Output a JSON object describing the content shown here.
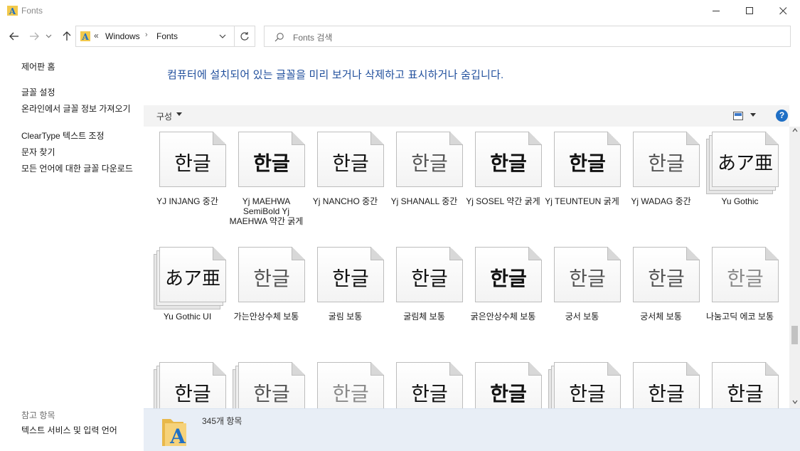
{
  "window": {
    "title": "Fonts"
  },
  "address": {
    "overflow": "«",
    "segments": [
      "Windows",
      "Fonts"
    ]
  },
  "search": {
    "placeholder": "Fonts 검색"
  },
  "left_pane": {
    "home": "제어판 홈",
    "links": [
      "글꼴 설정",
      "온라인에서 글꼴 정보 가져오기",
      "ClearType 텍스트 조정",
      "문자 찾기",
      "모든 언어에 대한 글꼴 다운로드"
    ],
    "see_also_title": "참고 항목",
    "see_also": [
      "텍스트 서비스 및 입력 언어"
    ]
  },
  "main": {
    "headline": "컴퓨터에 설치되어 있는 글꼴을 미리 보거나 삭제하고 표시하거나 숨깁니다.",
    "organize": "구성",
    "help": "?"
  },
  "fonts": [
    {
      "name": "YJ INJANG 중간",
      "sample": "한글",
      "stack": 1,
      "style": "serif"
    },
    {
      "name": "Yj MAEHWA SemiBold Yj MAEHWA 약간 굵게",
      "sample": "한글",
      "stack": 1,
      "style": "serif bold"
    },
    {
      "name": "Yj NANCHO 중간",
      "sample": "한글",
      "stack": 1,
      "style": "serif"
    },
    {
      "name": "Yj SHANALL 중간",
      "sample": "한글",
      "stack": 1,
      "style": "light"
    },
    {
      "name": "Yj SOSEL 약간 굵게",
      "sample": "한글",
      "stack": 1,
      "style": "bold"
    },
    {
      "name": "Yj TEUNTEUN 굵게",
      "sample": "한글",
      "stack": 1,
      "style": "bold"
    },
    {
      "name": "Yj WADAG 중간",
      "sample": "한글",
      "stack": 1,
      "style": "light"
    },
    {
      "name": "Yu Gothic",
      "sample": "あア亜",
      "stack": 3,
      "style": "jp"
    },
    {
      "name": "Yu Gothic UI",
      "sample": "あア亜",
      "stack": 3,
      "style": "jp"
    },
    {
      "name": "가는안상수체 보통",
      "sample": "한글",
      "stack": 1,
      "style": "light"
    },
    {
      "name": "굴림 보통",
      "sample": "한글",
      "stack": 1,
      "style": ""
    },
    {
      "name": "굴림체 보통",
      "sample": "한글",
      "stack": 1,
      "style": ""
    },
    {
      "name": "굵은안상수체 보통",
      "sample": "한글",
      "stack": 1,
      "style": "bold"
    },
    {
      "name": "궁서 보통",
      "sample": "한글",
      "stack": 1,
      "style": "serif light"
    },
    {
      "name": "궁서체 보통",
      "sample": "한글",
      "stack": 1,
      "style": "serif light"
    },
    {
      "name": "나눔고딕 에코 보통",
      "sample": "한글",
      "stack": 1,
      "style": "lighter"
    },
    {
      "name": "",
      "sample": "한글",
      "stack": 3,
      "style": ""
    },
    {
      "name": "",
      "sample": "한글",
      "stack": 3,
      "style": "light"
    },
    {
      "name": "",
      "sample": "한글",
      "stack": 1,
      "style": "lighter"
    },
    {
      "name": "",
      "sample": "한글",
      "stack": 1,
      "style": ""
    },
    {
      "name": "",
      "sample": "한글",
      "stack": 1,
      "style": "bold"
    },
    {
      "name": "",
      "sample": "한글",
      "stack": 3,
      "style": ""
    },
    {
      "name": "",
      "sample": "한글",
      "stack": 1,
      "style": "serif"
    },
    {
      "name": "",
      "sample": "한글",
      "stack": 1,
      "style": "serif"
    }
  ],
  "details": {
    "count": "345개 항목"
  }
}
